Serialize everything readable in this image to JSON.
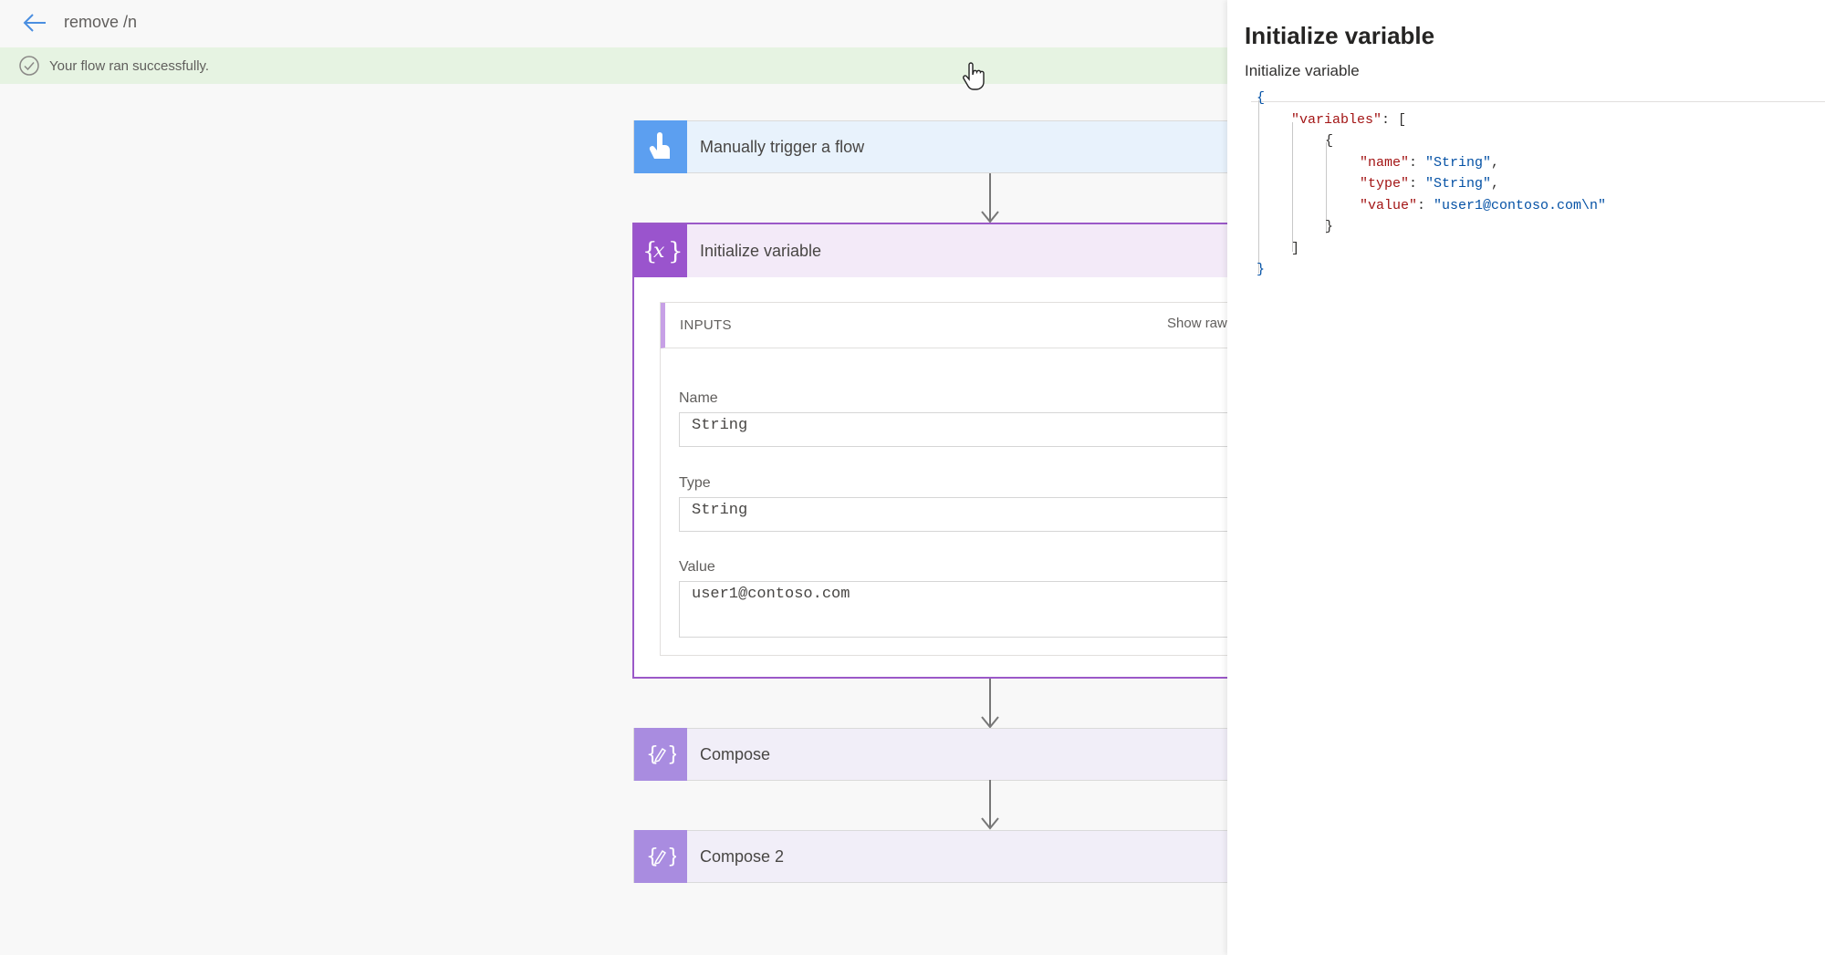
{
  "topbar": {
    "title": "remove /n",
    "success_message": "Your flow ran successfully."
  },
  "canvas": {
    "trigger_label": "Manually trigger a flow",
    "init_var": {
      "label": "Initialize variable",
      "inputs_heading": "INPUTS",
      "show_raw": "Show raw inputs",
      "fields": {
        "name_label": "Name",
        "name_value": "String",
        "type_label": "Type",
        "type_value": "String",
        "value_label": "Value",
        "value_value": "user1@contoso.com"
      }
    },
    "compose_label": "Compose",
    "compose2_label": "Compose 2"
  },
  "panel": {
    "title": "Initialize variable",
    "subtitle": "Initialize variable",
    "json": {
      "open_brace": "{",
      "variables_key": "\"variables\"",
      "colon": ": ",
      "open_bracket": "[",
      "item_open": "{",
      "name_key": "\"name\"",
      "name_val": "\"String\"",
      "type_key": "\"type\"",
      "type_val": "\"String\"",
      "value_key": "\"value\"",
      "value_val": "\"user1@contoso.com\\n\"",
      "comma": ",",
      "item_close": "}",
      "close_bracket": "]",
      "close_brace": "}"
    }
  },
  "colors": {
    "success_bg": "#e6f3e2",
    "trigger_icon": "#5c9ff0",
    "init_var_icon": "#9a54cd",
    "compose_icon": "#a98ce0",
    "json_key": "#a31515",
    "json_string": "#0451a5"
  }
}
